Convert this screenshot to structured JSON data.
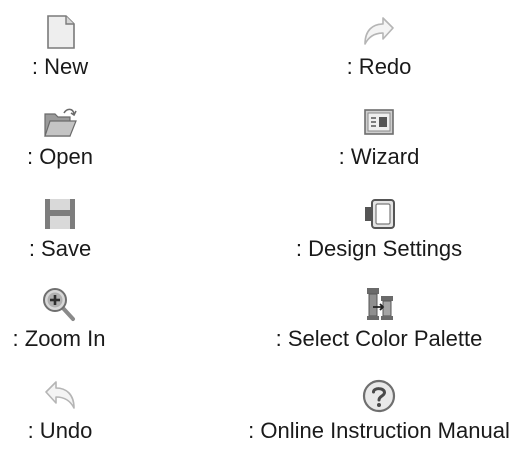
{
  "legend": {
    "new": {
      "icon": "new-document-icon",
      "label": ": New"
    },
    "open": {
      "icon": "open-folder-icon",
      "label": ": Open"
    },
    "save": {
      "icon": "save-disk-icon",
      "label": ": Save"
    },
    "zoom_in": {
      "icon": "zoom-in-icon",
      "label": ": Zoom In"
    },
    "undo": {
      "icon": "undo-arrow-icon",
      "label": ": Undo"
    },
    "redo": {
      "icon": "redo-arrow-icon",
      "label": ": Redo"
    },
    "wizard": {
      "icon": "wizard-icon",
      "label": ": Wizard"
    },
    "design_settings": {
      "icon": "design-settings-icon",
      "label": ": Design Settings"
    },
    "select_color_palette": {
      "icon": "color-palette-icon",
      "label": ": Select Color Palette"
    },
    "online_manual": {
      "icon": "help-question-icon",
      "label": ": Online Instruction Manual"
    }
  }
}
